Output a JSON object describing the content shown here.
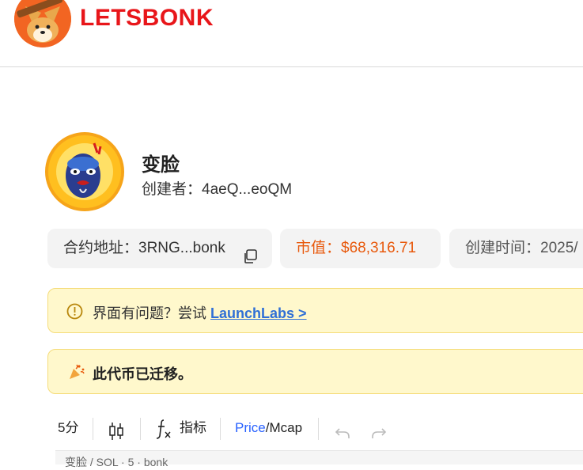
{
  "header": {
    "brand": "LETSBONK",
    "logo_icon": "shiba-dog-logo-icon"
  },
  "token": {
    "avatar_icon": "opera-mask-avatar",
    "name": "变脸",
    "creator_label": "创建者：",
    "creator_value": "4aeQ...eoQM"
  },
  "stats": {
    "contract_label": "合约地址：",
    "contract_value": "3RNG...bonk",
    "mcap_label": "市值：",
    "mcap_value": "$68,316.71",
    "created_label": "创建时间：",
    "created_value": "2025/"
  },
  "banners": {
    "warn_text": "界面有问题？尝试 ",
    "warn_link": "LaunchLabs >",
    "migrated_text": "此代币已迁移。"
  },
  "toolbar": {
    "interval": "5分",
    "indicators_label": "指标",
    "price_label": "Price",
    "slash": "/",
    "mcap_label": "Mcap"
  },
  "chart": {
    "legend": "变脸 / SOL · 5 · bonk"
  },
  "colors": {
    "brand": "#e8161a",
    "mcap": "#e8590c",
    "link": "#2f6fd6",
    "active_toggle": "#2962ff",
    "banner_bg": "#fff8cc"
  }
}
